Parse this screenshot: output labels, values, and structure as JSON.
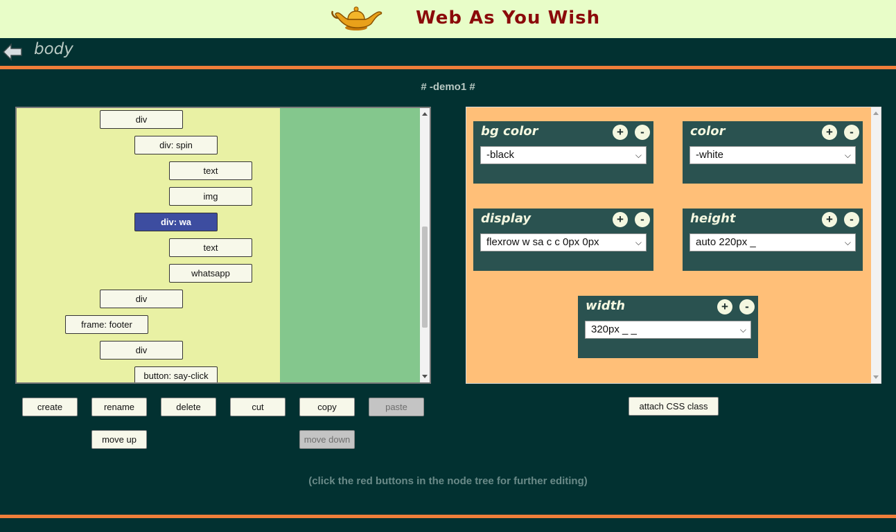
{
  "header": {
    "app_title": "Web As You Wish",
    "logo_icon": "magic-lamp-icon"
  },
  "nav": {
    "back_icon": "arrow-left-icon",
    "breadcrumb": "body"
  },
  "demo_title": "# -demo1 #",
  "tree": {
    "nodes": [
      {
        "label": "div"
      },
      {
        "label": "div: spin"
      },
      {
        "label": "text"
      },
      {
        "label": "img"
      },
      {
        "label": "div: wa",
        "selected": true
      },
      {
        "label": "text"
      },
      {
        "label": "whatsapp"
      },
      {
        "label": "div"
      },
      {
        "label": "frame: footer"
      },
      {
        "label": "div"
      },
      {
        "label": "button: say-click"
      }
    ]
  },
  "css_props": [
    {
      "name": "bg color",
      "value": "-black"
    },
    {
      "name": "color",
      "value": "-white"
    },
    {
      "name": "display",
      "value": "flexrow w sa c c 0px 0px"
    },
    {
      "name": "height",
      "value": "auto 220px _"
    },
    {
      "name": "width",
      "value": "320px _ _"
    }
  ],
  "css_controls": {
    "plus": "+",
    "minus": "-"
  },
  "actions": {
    "create": "create",
    "rename": "rename",
    "delete": "delete",
    "cut": "cut",
    "copy": "copy",
    "paste": "paste",
    "move_up": "move up",
    "move_down": "move down",
    "attach_css": "attach CSS class"
  },
  "hint": "(click the red buttons in the node tree for further editing)",
  "colors": {
    "header_bg": "#e8fdc8",
    "page_bg": "#023131",
    "accent_line": "#f07e3a",
    "title_red": "#8b0a0a",
    "tree_bg": "#e9f1a4",
    "tree_green": "#84c78d",
    "selected_node": "#3d4da0",
    "css_panel_bg": "#ffbf78",
    "prop_box": "#2a5250"
  }
}
